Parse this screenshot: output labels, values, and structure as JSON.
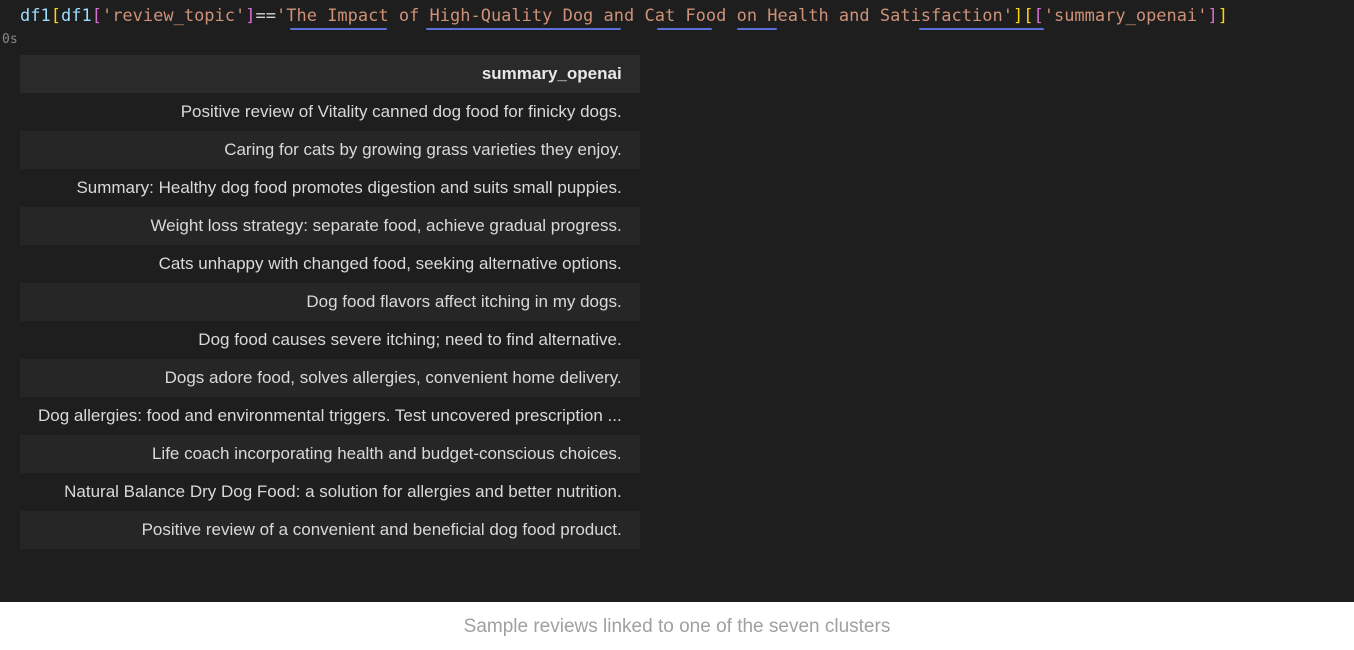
{
  "code": {
    "var": "df1",
    "col1": "review_topic",
    "eq": "==",
    "str_value": "The Impact of High-Quality Dog and Cat Food on Health and Satisfaction",
    "col2": "summary_openai"
  },
  "exec_time": "0s",
  "table": {
    "header": "summary_openai",
    "rows": [
      "Positive review of Vitality canned dog food for finicky dogs.",
      "Caring for cats by growing grass varieties they enjoy.",
      "Summary: Healthy dog food promotes digestion and suits small puppies.",
      "Weight loss strategy: separate food, achieve gradual progress.",
      "Cats unhappy with changed food, seeking alternative options.",
      "Dog food flavors affect itching in my dogs.",
      "Dog food causes severe itching; need to find alternative.",
      "Dogs adore food, solves allergies, convenient home delivery.",
      "Dog allergies: food and environmental triggers. Test uncovered prescription ...",
      "Life coach incorporating health and budget-conscious choices.",
      "Natural Balance Dry Dog Food: a solution for allergies and better nutrition.",
      "Positive review of a convenient and beneficial dog food product."
    ]
  },
  "caption": "Sample reviews linked to one of the seven clusters"
}
